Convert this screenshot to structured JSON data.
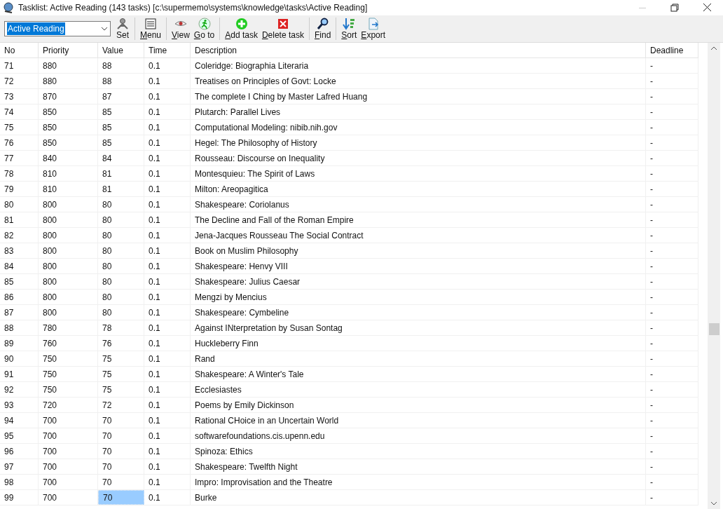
{
  "window": {
    "title": "Tasklist: Active Reading (143 tasks) [c:\\supermemo\\systems\\knowledge\\tasks\\Active Reading]"
  },
  "toolbar": {
    "tasklist_select": {
      "value": "Active Reading"
    },
    "buttons": [
      {
        "kind": "set",
        "label": "Set",
        "underlined_key": false
      },
      {
        "kind": "menu",
        "label": "Menu",
        "underlined_key": true
      },
      {
        "kind": "view",
        "label": "View",
        "underlined_key": true
      },
      {
        "kind": "goto",
        "label": "Go to",
        "underlined_key": true
      },
      {
        "kind": "add",
        "label": "Add task",
        "underlined_key": true
      },
      {
        "kind": "delete",
        "label": "Delete task",
        "underlined_key": true
      },
      {
        "kind": "find",
        "label": "Find",
        "underlined_key": true
      },
      {
        "kind": "sort",
        "label": "Sort",
        "underlined_key": true
      },
      {
        "kind": "export",
        "label": "Export",
        "underlined_key": true
      }
    ]
  },
  "table": {
    "columns": [
      "No",
      "Priority",
      "Value",
      "Time",
      "Description",
      "Deadline"
    ],
    "rows": [
      {
        "cells": [
          "71",
          "880",
          "88",
          "0.1",
          "Coleridge: Biographia Literaria",
          "-"
        ],
        "selected": false
      },
      {
        "cells": [
          "72",
          "880",
          "88",
          "0.1",
          "Treatises on Principles of Govt: Locke",
          "-"
        ],
        "selected": false
      },
      {
        "cells": [
          "73",
          "870",
          "87",
          "0.1",
          "The complete I Ching by Master Lafred Huang",
          "-"
        ],
        "selected": false
      },
      {
        "cells": [
          "74",
          "850",
          "85",
          "0.1",
          "Plutarch: Parallel Lives",
          "-"
        ],
        "selected": false
      },
      {
        "cells": [
          "75",
          "850",
          "85",
          "0.1",
          "Computational Modeling: nibib.nih.gov",
          "-"
        ],
        "selected": false
      },
      {
        "cells": [
          "76",
          "850",
          "85",
          "0.1",
          "Hegel: The Philosophy of History",
          "-"
        ],
        "selected": false
      },
      {
        "cells": [
          "77",
          "840",
          "84",
          "0.1",
          "Rousseau: Discourse on Inequality",
          "-"
        ],
        "selected": false
      },
      {
        "cells": [
          "78",
          "810",
          "81",
          "0.1",
          "Montesquieu: The Spirit of Laws",
          "-"
        ],
        "selected": false
      },
      {
        "cells": [
          "79",
          "810",
          "81",
          "0.1",
          "Milton: Areopagitica",
          "-"
        ],
        "selected": false
      },
      {
        "cells": [
          "80",
          "800",
          "80",
          "0.1",
          "Shakespeare: Coriolanus",
          "-"
        ],
        "selected": false
      },
      {
        "cells": [
          "81",
          "800",
          "80",
          "0.1",
          "The Decline and Fall of the Roman Empire",
          "-"
        ],
        "selected": false
      },
      {
        "cells": [
          "82",
          "800",
          "80",
          "0.1",
          "Jena-Jacques Rousseau The Social Contract",
          "-"
        ],
        "selected": false
      },
      {
        "cells": [
          "83",
          "800",
          "80",
          "0.1",
          "Book on Muslim Philosophy",
          "-"
        ],
        "selected": false
      },
      {
        "cells": [
          "84",
          "800",
          "80",
          "0.1",
          "Shakespeare: Henvy VIII",
          "-"
        ],
        "selected": false
      },
      {
        "cells": [
          "85",
          "800",
          "80",
          "0.1",
          "Shakespeare: Julius Caesar",
          "-"
        ],
        "selected": false
      },
      {
        "cells": [
          "86",
          "800",
          "80",
          "0.1",
          "Mengzi by Mencius",
          "-"
        ],
        "selected": false
      },
      {
        "cells": [
          "87",
          "800",
          "80",
          "0.1",
          "Shakespeare: Cymbeline",
          "-"
        ],
        "selected": false
      },
      {
        "cells": [
          "88",
          "780",
          "78",
          "0.1",
          "Against INterpretation by Susan Sontag",
          "-"
        ],
        "selected": false
      },
      {
        "cells": [
          "89",
          "760",
          "76",
          "0.1",
          "Huckleberry Finn",
          "-"
        ],
        "selected": false
      },
      {
        "cells": [
          "90",
          "750",
          "75",
          "0.1",
          "Rand",
          "-"
        ],
        "selected": false
      },
      {
        "cells": [
          "91",
          "750",
          "75",
          "0.1",
          "Shakespeare: A Winter's Tale",
          "-"
        ],
        "selected": false
      },
      {
        "cells": [
          "92",
          "750",
          "75",
          "0.1",
          "Ecclesiastes",
          "-"
        ],
        "selected": false
      },
      {
        "cells": [
          "93",
          "720",
          "72",
          "0.1",
          "Poems by Emily Dickinson",
          "-"
        ],
        "selected": false
      },
      {
        "cells": [
          "94",
          "700",
          "70",
          "0.1",
          "Rational CHoice in an Uncertain World",
          "-"
        ],
        "selected": false
      },
      {
        "cells": [
          "95",
          "700",
          "70",
          "0.1",
          "softwarefoundations.cis.upenn.edu",
          "-"
        ],
        "selected": false
      },
      {
        "cells": [
          "96",
          "700",
          "70",
          "0.1",
          "Spinoza: Ethics",
          "-"
        ],
        "selected": false
      },
      {
        "cells": [
          "97",
          "700",
          "70",
          "0.1",
          "Shakespeare: Twelfth Night",
          "-"
        ],
        "selected": false
      },
      {
        "cells": [
          "98",
          "700",
          "70",
          "0.1",
          "Impro: Improvisation and the Theatre",
          "-"
        ],
        "selected": false
      },
      {
        "cells": [
          "99",
          "700",
          "70",
          "0.1",
          "Burke",
          "-"
        ],
        "selected": true
      }
    ]
  }
}
